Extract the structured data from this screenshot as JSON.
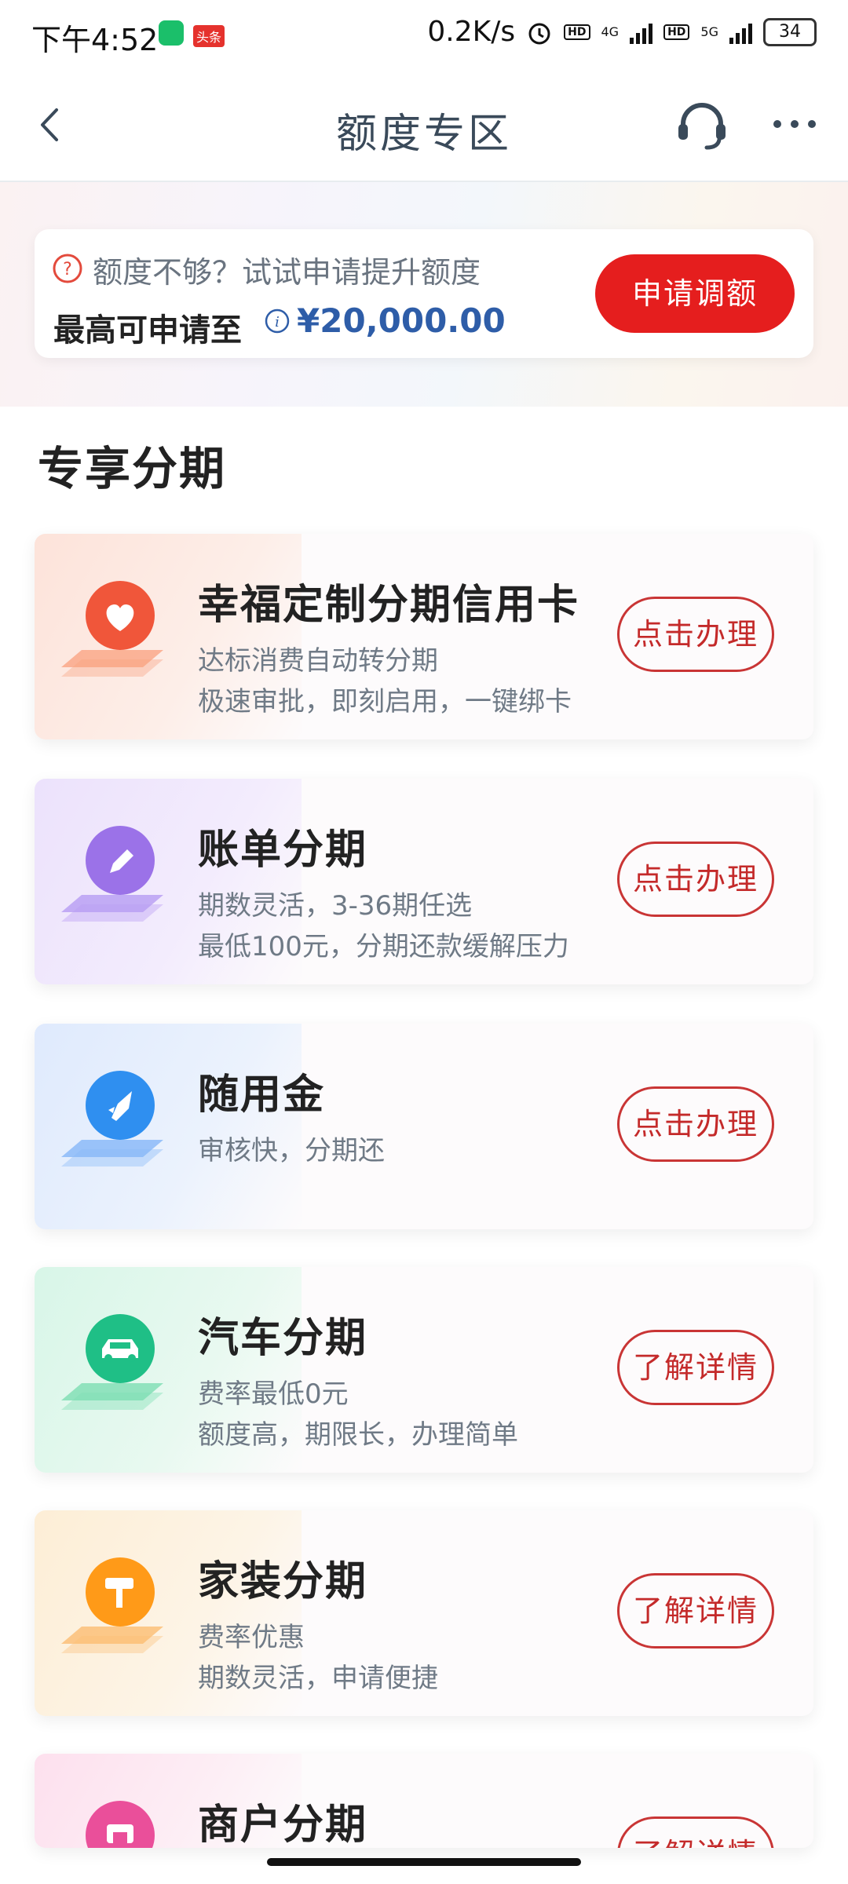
{
  "status_bar": {
    "time": "下午4:52",
    "toutiao_badge": "头条",
    "net_speed": "0.2K/s",
    "hd1": "HD",
    "net1": "4G",
    "hd2": "HD",
    "net2": "5G",
    "battery": "34"
  },
  "nav": {
    "title": "额度专区"
  },
  "quota": {
    "prompt": "额度不够？试试申请提升额度",
    "label": "最高可申请至",
    "amount": "¥20,000.00",
    "apply_button": "申请调额"
  },
  "section_title": "专享分期",
  "products": [
    {
      "title": "幸福定制分期信用卡",
      "desc1": "达标消费自动转分期",
      "desc2": "极速审批，即刻启用，一键绑卡",
      "button": "点击办理",
      "icon": "heart-icon",
      "color": "#f0563a"
    },
    {
      "title": "账单分期",
      "desc1": "期数灵活，3-36期任选",
      "desc2": "最低100元，分期还款缓解压力",
      "button": "点击办理",
      "icon": "pencil-icon",
      "color": "#9b72e8"
    },
    {
      "title": "随用金",
      "desc1": "审核快，分期还",
      "desc2": "",
      "button": "点击办理",
      "icon": "rocket-icon",
      "color": "#2f8ff0"
    },
    {
      "title": "汽车分期",
      "desc1": "费率最低0元",
      "desc2": "额度高，期限长，办理简单",
      "button": "了解详情",
      "icon": "car-icon",
      "color": "#1fbf86"
    },
    {
      "title": "家装分期",
      "desc1": "费率优惠",
      "desc2": "期数灵活，申请便捷",
      "button": "了解详情",
      "icon": "paint-roller-icon",
      "color": "#ff9a18"
    },
    {
      "title": "商户分期",
      "desc1": "",
      "desc2": "",
      "button": "了解详情",
      "icon": "store-icon",
      "color": "#ea4f9a"
    }
  ]
}
